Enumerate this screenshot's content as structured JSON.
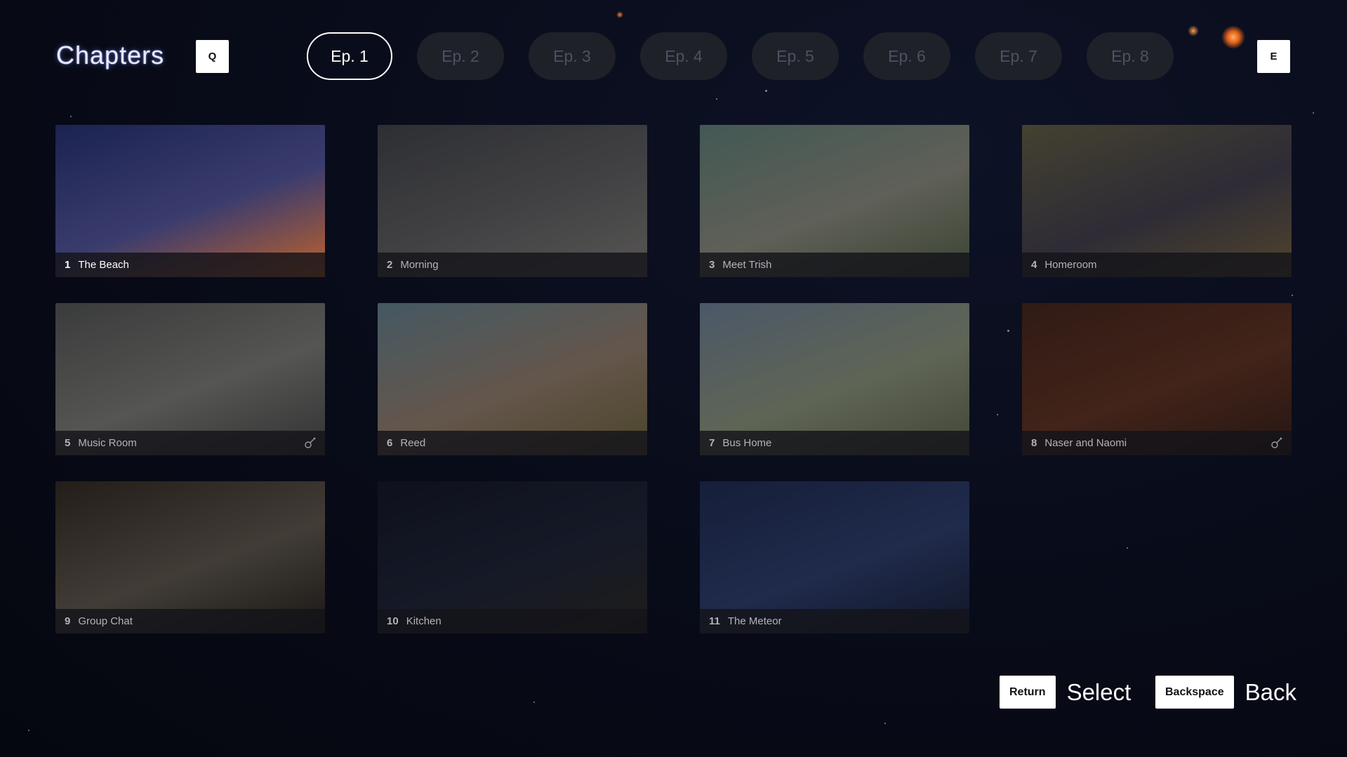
{
  "header": {
    "title": "Chapters",
    "prev_key": "Q",
    "next_key": "E"
  },
  "tabs": [
    {
      "label": "Ep. 1",
      "active": true
    },
    {
      "label": "Ep. 2",
      "active": false
    },
    {
      "label": "Ep. 3",
      "active": false
    },
    {
      "label": "Ep. 4",
      "active": false
    },
    {
      "label": "Ep. 5",
      "active": false
    },
    {
      "label": "Ep. 6",
      "active": false
    },
    {
      "label": "Ep. 7",
      "active": false
    },
    {
      "label": "Ep. 8",
      "active": false
    }
  ],
  "chapters": [
    {
      "num": "1",
      "title": "The Beach",
      "icon": "",
      "colors": [
        "#1a2352",
        "#3b3c6e",
        "#c0622a"
      ]
    },
    {
      "num": "2",
      "title": "Morning",
      "icon": "",
      "colors": [
        "#4a4c52",
        "#6b6b6f",
        "#8d8b86"
      ]
    },
    {
      "num": "3",
      "title": "Meet Trish",
      "icon": "",
      "colors": [
        "#6d8f88",
        "#9a9b8e",
        "#5f6f52"
      ]
    },
    {
      "num": "4",
      "title": "Homeroom",
      "icon": "",
      "colors": [
        "#6e6a4e",
        "#4b4757",
        "#836f48"
      ]
    },
    {
      "num": "5",
      "title": "Music Room",
      "icon": "guitar-icon",
      "colors": [
        "#5e6060",
        "#8a8a86",
        "#505252"
      ]
    },
    {
      "num": "6",
      "title": "Reed",
      "icon": "",
      "colors": [
        "#708fa0",
        "#a28c7a",
        "#7a6f44"
      ]
    },
    {
      "num": "7",
      "title": "Bus Home",
      "icon": "",
      "colors": [
        "#7a8ea8",
        "#9aa48a",
        "#6b705a"
      ]
    },
    {
      "num": "8",
      "title": "Naser and Naomi",
      "icon": "guitar-icon",
      "colors": [
        "#4e2c22",
        "#6b3a2a",
        "#3d251e"
      ]
    },
    {
      "num": "9",
      "title": "Group Chat",
      "icon": "",
      "colors": [
        "#3a302a",
        "#6a6258",
        "#2c2622"
      ]
    },
    {
      "num": "10",
      "title": "Kitchen",
      "icon": "",
      "colors": [
        "#171c2e",
        "#232a40",
        "#33302a"
      ]
    },
    {
      "num": "11",
      "title": "The Meteor",
      "icon": "",
      "colors": [
        "#23325e",
        "#34457a",
        "#1c2540"
      ]
    }
  ],
  "footer": {
    "select_key": "Return",
    "select_label": "Select",
    "back_key": "Backspace",
    "back_label": "Back"
  }
}
